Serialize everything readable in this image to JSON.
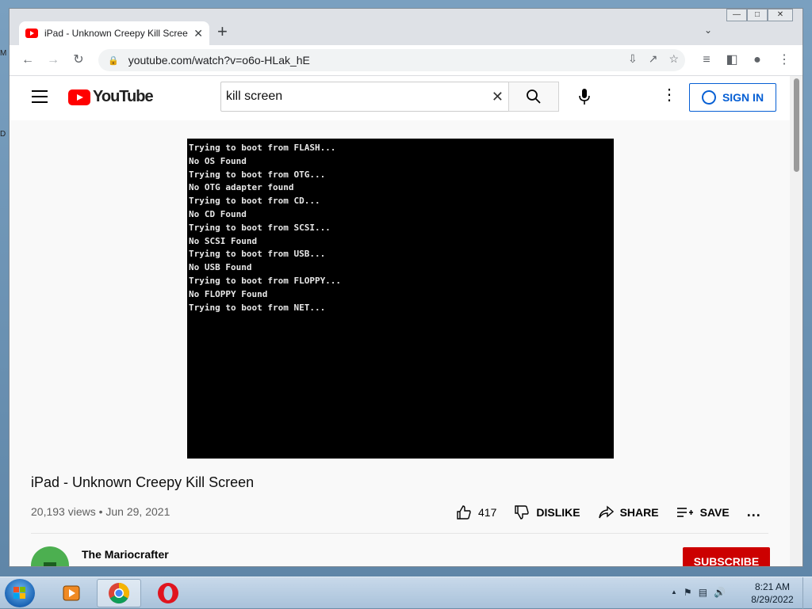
{
  "desktop": {
    "frag1": "M",
    "frag2": "D"
  },
  "browser": {
    "tab_title": "iPad - Unknown Creepy Kill Scree",
    "tab_close": "✕",
    "new_tab": "+",
    "url": "youtube.com/watch?v=o6o-HLak_hE",
    "icons": {
      "back": "arrow-left-icon",
      "forward": "arrow-right-icon",
      "reload": "reload-icon",
      "lock": "lock-icon"
    }
  },
  "youtube": {
    "logo_text": "YouTube",
    "search_value": "kill screen",
    "signin_label": "SIGN IN",
    "video": {
      "console_lines": [
        "Trying to boot from FLASH...",
        "No OS Found",
        "Trying to boot from OTG...",
        "No OTG adapter found",
        "Trying to boot from CD...",
        "No CD Found",
        "Trying to boot from SCSI...",
        "No SCSI Found",
        "Trying to boot from USB...",
        "No USB Found",
        "Trying to boot from FLOPPY...",
        "No FLOPPY Found",
        "Trying to boot from NET..."
      ],
      "title": "iPad - Unknown Creepy Kill Screen",
      "meta": "20,193 views • Jun 29, 2021",
      "likes": "417",
      "dislike_label": "DISLIKE",
      "share_label": "SHARE",
      "save_label": "SAVE",
      "more": "...",
      "channel_name": "The Mariocrafter",
      "subscribe_label": "SUBSCRIBE"
    }
  },
  "taskbar": {
    "time": "8:21 AM",
    "date": "8/29/2022",
    "tray_arrow": "▲"
  },
  "colors": {
    "brand_red": "#ff0000",
    "subscribe_red": "#cc0000",
    "link_blue": "#065fd4"
  }
}
